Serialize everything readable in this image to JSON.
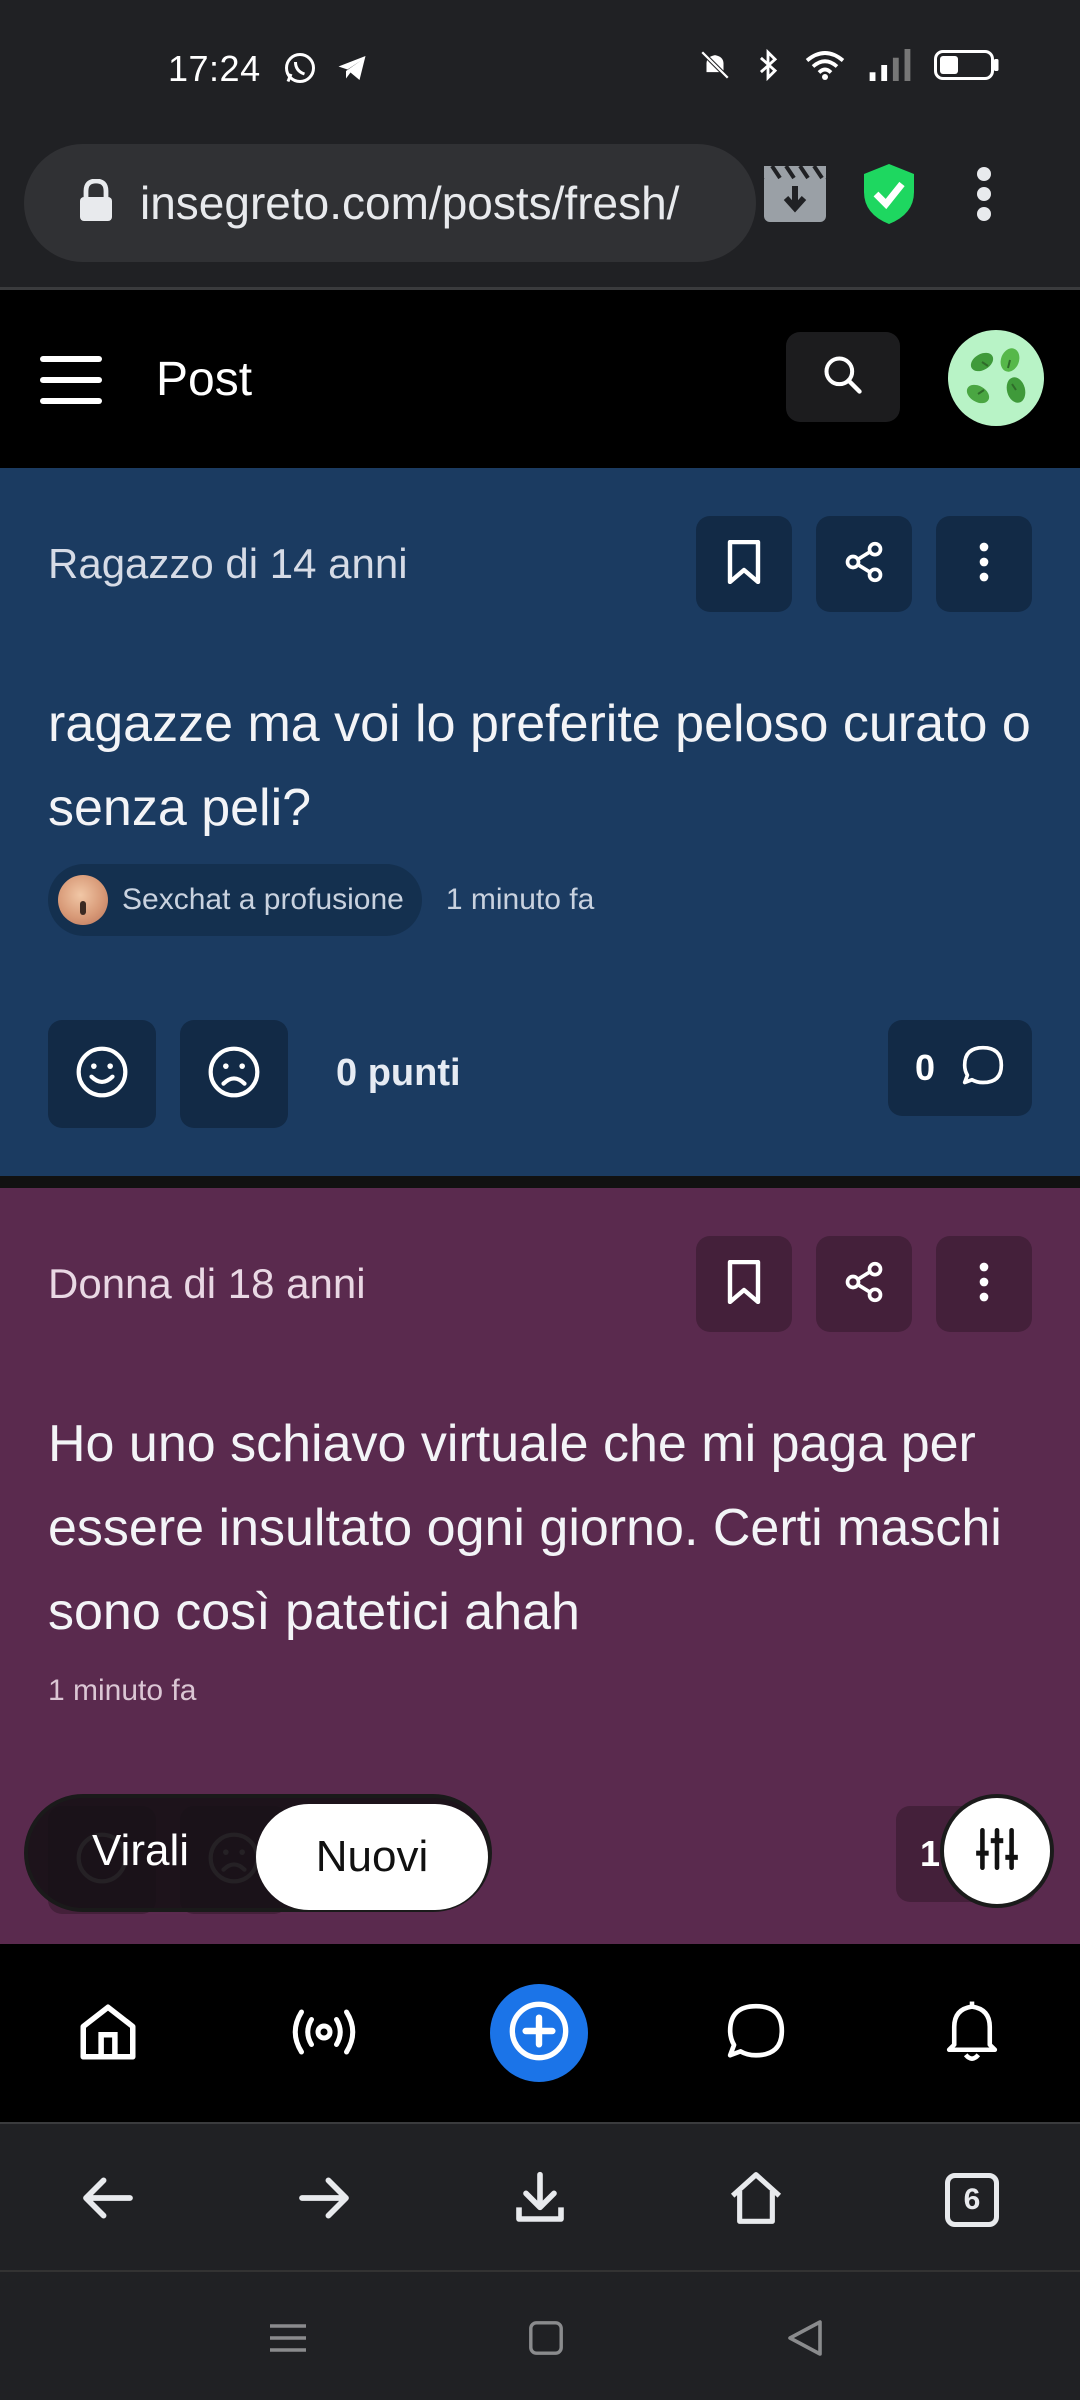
{
  "status_bar": {
    "time": "17:24",
    "left_icons": [
      "whatsapp-icon",
      "telegram-icon"
    ],
    "right_icons": [
      "mute-icon",
      "bluetooth-icon",
      "wifi-icon",
      "signal-icon",
      "battery-icon"
    ]
  },
  "browser": {
    "url": "insegreto.com/posts/fresh/",
    "tab_count": "6"
  },
  "header": {
    "title": "Post"
  },
  "posts": [
    {
      "author": "Ragazzo di 14 anni",
      "text": "ragazze ma voi lo preferite peloso curato o senza peli?",
      "chip_label": "Sexchat a profusione",
      "time": "1 minuto fa",
      "points": "0 punti",
      "comments": "0",
      "color": "#1b3b61"
    },
    {
      "author": "Donna di 18 anni",
      "text": "Ho uno schiavo virtuale che mi paga per essere insultato ogni giorno. Certi maschi sono così patetici ahah",
      "time": "1 minuto fa",
      "comments": "1",
      "color": "#5a2a4e"
    }
  ],
  "feed_toggle": {
    "options": [
      "Virali",
      "Nuovi"
    ],
    "selected": "Nuovi"
  },
  "colors": {
    "accent_blue": "#1b74e8",
    "shield_green": "#1ed760"
  }
}
